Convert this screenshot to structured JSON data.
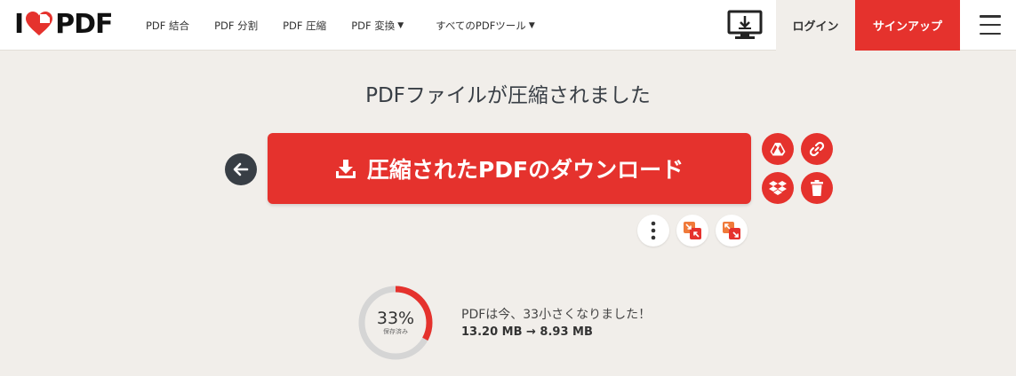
{
  "header": {
    "logo_left": "I",
    "logo_right": "PDF",
    "nav": [
      {
        "label": "PDF 結合",
        "dropdown": false
      },
      {
        "label": "PDF 分割",
        "dropdown": false
      },
      {
        "label": "PDF 圧縮",
        "dropdown": false
      },
      {
        "label": "PDF 変換",
        "dropdown": true
      },
      {
        "label": "すべてのPDFツール",
        "dropdown": true
      }
    ],
    "login_label": "ログイン",
    "signup_label": "サインアップ"
  },
  "main": {
    "title": "PDFファイルが圧縮されました",
    "download_label": "圧縮されたPDFのダウンロード"
  },
  "result": {
    "percent": 33,
    "percent_text": "33%",
    "saved_label": "保存済み",
    "message": "PDFは今、33小さくなりました！",
    "sizes": "13.20 MB → 8.93 MB"
  },
  "colors": {
    "accent": "#e5322d",
    "dark": "#383e45",
    "background": "#f1eeea",
    "ring_track": "#d5d5d5"
  },
  "icons": {
    "back": "arrow-left-icon",
    "download": "download-icon",
    "google_drive": "google-drive-icon",
    "link": "link-icon",
    "dropbox": "dropbox-icon",
    "delete": "trash-icon",
    "more": "more-vertical-icon",
    "tool_a": "compress-tool-icon",
    "tool_b": "resize-tool-icon",
    "desktop": "desktop-download-icon",
    "menu": "hamburger-icon"
  }
}
